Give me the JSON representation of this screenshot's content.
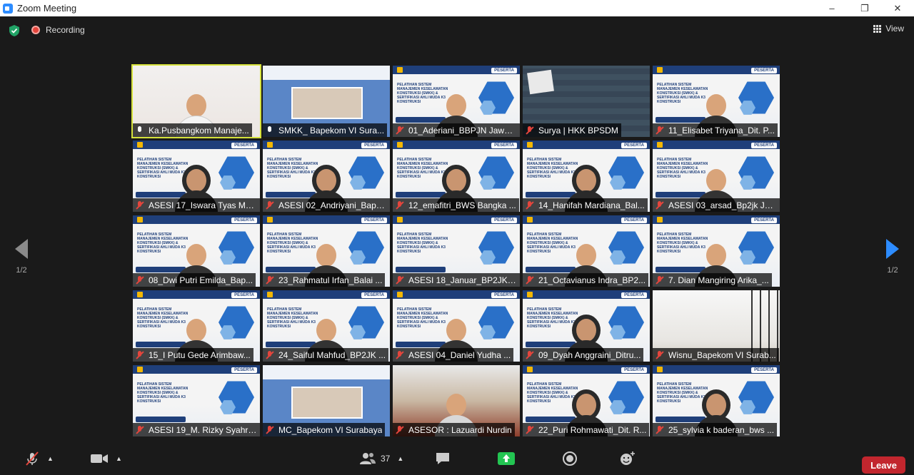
{
  "window": {
    "title": "Zoom Meeting",
    "minimize": "–",
    "restore": "❐",
    "close": "✕"
  },
  "status": {
    "recording_label": "Recording",
    "view_label": "View"
  },
  "pager": {
    "left": "1/2",
    "right": "1/2"
  },
  "slide": {
    "badge": "PESERTA",
    "text": "PELATIHAN SISTEM MANAJEMEN KESELAMATAN KONSTRUKSI (SMKK) & SERTIFIKASI AHLI MUDA K3 KONSTRUKSI"
  },
  "participants": [
    {
      "name": "Ka.Pusbangkom Manaje...",
      "muted": false,
      "kind": "photo",
      "active": true
    },
    {
      "name": "SMKK_ Bapekom VI Sura...",
      "muted": false,
      "kind": "banner"
    },
    {
      "name": "01_Aderiani_BBPJN Jawa ...",
      "muted": true,
      "kind": "slide-person"
    },
    {
      "name": "Surya | HKK BPSDM",
      "muted": true,
      "kind": "zoomroom"
    },
    {
      "name": "11_Elisabet Triyana_Dit. P...",
      "muted": true,
      "kind": "slide-person"
    },
    {
      "name": "ASESI 17_Iswara Tyas Ma...",
      "muted": true,
      "kind": "slide-hijab"
    },
    {
      "name": "ASESI 02_Andriyani_Bape...",
      "muted": true,
      "kind": "slide-hijab"
    },
    {
      "name": "12_emafitri_BWS Bangka ...",
      "muted": true,
      "kind": "slide-hijab"
    },
    {
      "name": "14_Hanifah Mardiana_Bal...",
      "muted": true,
      "kind": "slide-hijab"
    },
    {
      "name": "ASESI 03_arsad_Bp2jk Jat...",
      "muted": true,
      "kind": "slide-person"
    },
    {
      "name": "08_Dwi Putri Emilda_Bap...",
      "muted": true,
      "kind": "slide-person"
    },
    {
      "name": "23_Rahmatul Irfan_Balai ...",
      "muted": true,
      "kind": "slide-person"
    },
    {
      "name": "ASESI 18_Januar_BP2JK S...",
      "muted": true,
      "kind": "slide"
    },
    {
      "name": "21_Octavianus Indra_BP2...",
      "muted": true,
      "kind": "slide-person"
    },
    {
      "name": "7. Dian Mangiring Arika_...",
      "muted": true,
      "kind": "slide-person"
    },
    {
      "name": "15_I Putu Gede Arimbaw...",
      "muted": true,
      "kind": "slide-person"
    },
    {
      "name": "24_Saiful Mahfud_BP2JK ...",
      "muted": true,
      "kind": "slide-person"
    },
    {
      "name": "ASESI 04_Daniel Yudha ...",
      "muted": true,
      "kind": "slide-person"
    },
    {
      "name": "09_Dyah Anggraini_Ditru...",
      "muted": true,
      "kind": "slide-hijab"
    },
    {
      "name": "Wisnu_Bapekom VI Surab...",
      "muted": true,
      "kind": "room"
    },
    {
      "name": "ASESI 19_M. Rizky Syahra...",
      "muted": true,
      "kind": "slide"
    },
    {
      "name": "MC_Bapekom VI Surabaya",
      "muted": true,
      "kind": "banner"
    },
    {
      "name": "ASESOR : Lazuardi Nurdin",
      "muted": true,
      "kind": "building"
    },
    {
      "name": "22_Puri Rohmawati_Dit. R...",
      "muted": true,
      "kind": "slide-hijab"
    },
    {
      "name": "25_sylvia k baderan_bws ...",
      "muted": true,
      "kind": "slide-hijab"
    }
  ],
  "toolbar": {
    "participants_count": "37",
    "leave_label": "Leave"
  }
}
